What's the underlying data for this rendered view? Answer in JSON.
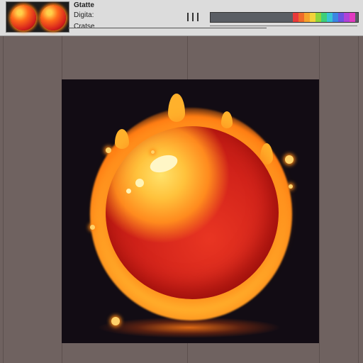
{
  "toolbar": {
    "title": "Gtatte",
    "subtitle_1": "Digita:",
    "subtitle_2": "Cratse",
    "thumbnail_icons": [
      "fire-orb-icon",
      "fire-orb-icon"
    ],
    "palette_colors": [
      "#e83a3a",
      "#ef6a2a",
      "#f4a32b",
      "#f3d23a",
      "#8fd53b",
      "#3ecf7a",
      "#37c4d4",
      "#3b86e3",
      "#6b54e0",
      "#b042d8",
      "#e23ac0"
    ]
  },
  "canvas": {
    "artwork_icon": "fire-orb-icon",
    "background_color": "#120c14"
  }
}
